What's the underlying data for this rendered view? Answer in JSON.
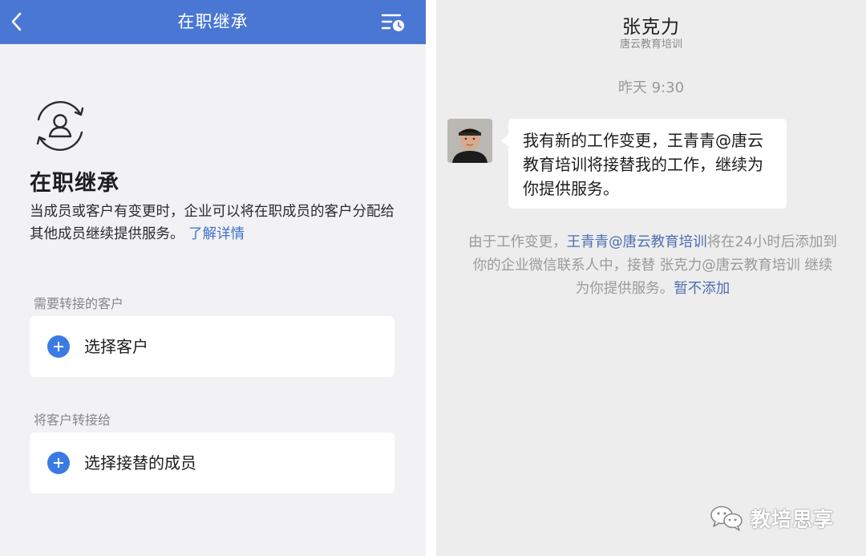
{
  "left": {
    "nav": {
      "title": "在职继承",
      "back_icon": "chevron-left-icon",
      "menu_icon": "list-clock-icon"
    },
    "hero_icon": "person-transfer-icon",
    "title": "在职继承",
    "description": "当成员或客户有变更时，企业可以将在职成员的客户分配给其他成员继续提供服务。",
    "learn_more": "了解详情",
    "sections": [
      {
        "label": "需要转接的客户",
        "action": "选择客户"
      },
      {
        "label": "将客户转接给",
        "action": "选择接替的成员"
      }
    ]
  },
  "right": {
    "contact_name": "张克力",
    "contact_org": "唐云教育培训",
    "time": "昨天 9:30",
    "message": "我有新的工作变更，王青青@唐云教育培训将接替我的工作，继续为你提供服务。",
    "system": {
      "prefix": "由于工作变更，",
      "highlight": "王青青@唐云教育培训",
      "middle": "将在24小时后添加到你的企业微信联系人中，接替 张克力@唐云教育培训 继续为你提供服务。",
      "action": "暂不添加"
    },
    "watermark": "教培思享"
  },
  "colors": {
    "nav_bg": "#4a77d3",
    "link_blue": "#3f6fcf",
    "plus_blue": "#3a7be3",
    "left_bg": "#f2f2f4",
    "chat_bg": "#ededed"
  }
}
